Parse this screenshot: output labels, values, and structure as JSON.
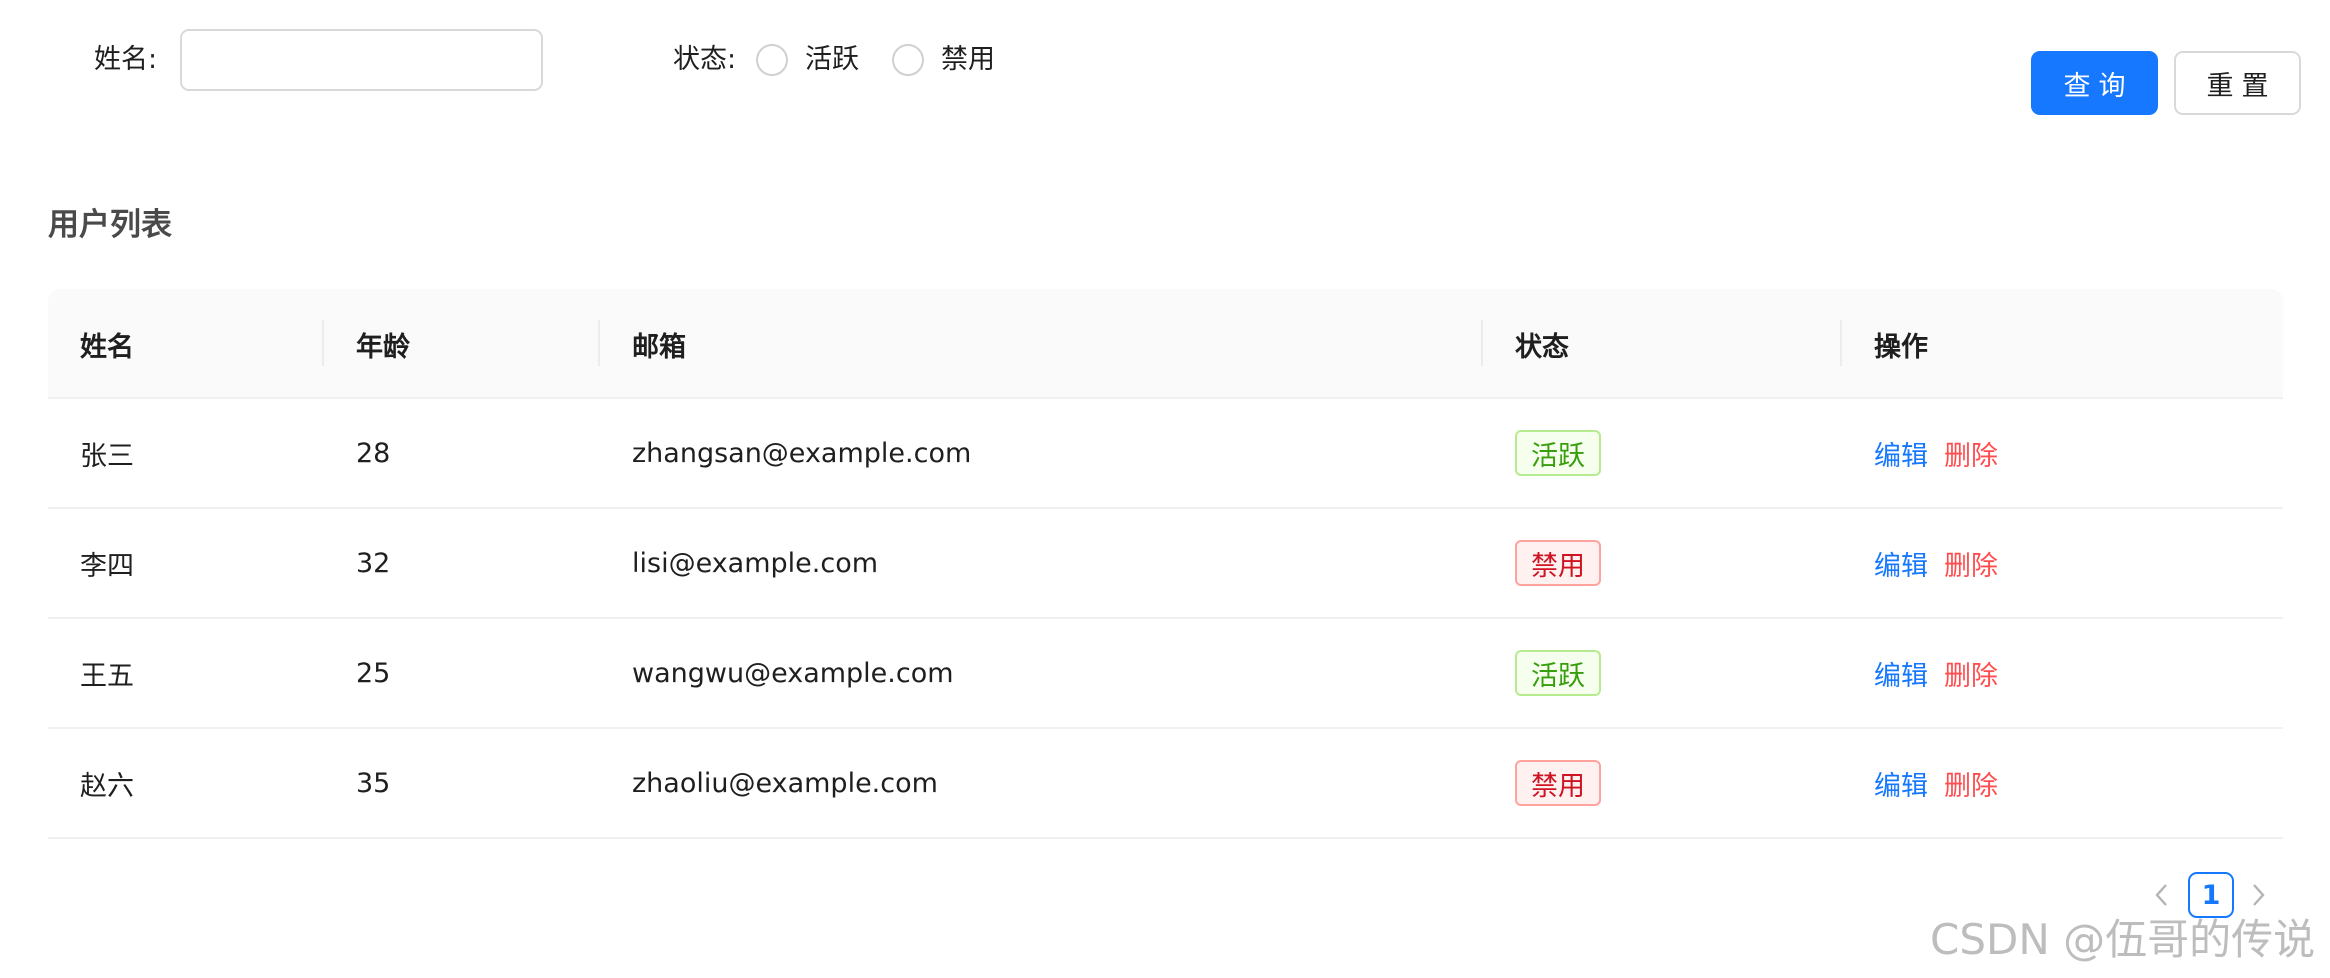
{
  "search": {
    "name_label": "姓名:",
    "name_value": "",
    "name_placeholder": "",
    "status_label": "状态:",
    "status_options": [
      "活跃",
      "禁用"
    ],
    "query_button": "查询",
    "reset_button": "重置"
  },
  "list": {
    "title": "用户列表",
    "columns": [
      "姓名",
      "年龄",
      "邮箱",
      "状态",
      "操作"
    ],
    "rows": [
      {
        "name": "张三",
        "age": "28",
        "email": "zhangsan@example.com",
        "status": "活跃"
      },
      {
        "name": "李四",
        "age": "32",
        "email": "lisi@example.com",
        "status": "禁用"
      },
      {
        "name": "王五",
        "age": "25",
        "email": "wangwu@example.com",
        "status": "活跃"
      },
      {
        "name": "赵六",
        "age": "35",
        "email": "zhaoliu@example.com",
        "status": "禁用"
      }
    ],
    "actions": {
      "edit": "编辑",
      "delete": "删除"
    }
  },
  "pagination": {
    "current": "1"
  },
  "watermark": "CSDN @伍哥的传说",
  "colors": {
    "primary": "#1677ff",
    "danger": "#ff4d4f",
    "success_tag": "#389e0d",
    "error_tag": "#cf1322"
  }
}
